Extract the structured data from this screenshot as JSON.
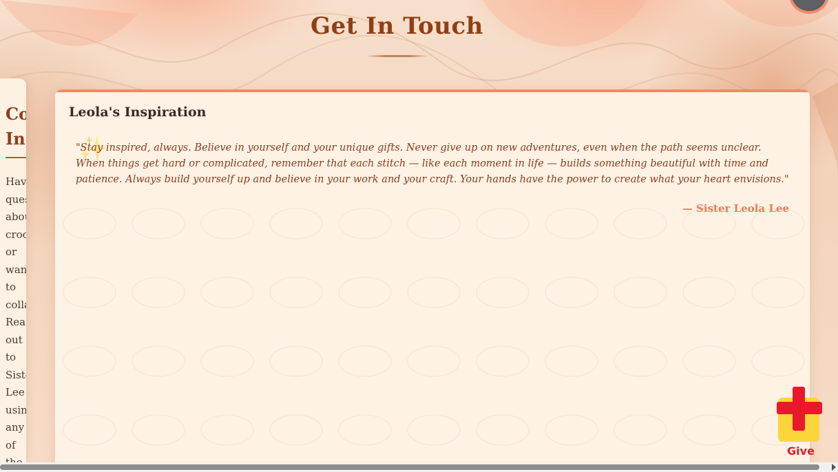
{
  "header": {
    "title": "Get In Touch"
  },
  "left_card": {
    "title": "Co\nIn",
    "text": "Hav\nques\nabou\ncroc\nor\nwan\nto\ncolla\nReac\nout\nto\nSiste\nLee\nusin\nany\nof\nthe"
  },
  "inspiration": {
    "title": "Leola's Inspiration",
    "quote": "\"Stay inspired, always. Believe in yourself and your unique gifts. Never give up on new adventures, even when the path seems unclear. When things get hard or complicated, remember that each stitch — like each moment in life — builds something beautiful with time and patience. Always build yourself up and believe in your work and your craft. Your hands have the power to create what your heart envisions.\"",
    "attribution": "— Sister Leola Lee",
    "icon": "sparkle-icon"
  },
  "give_widget": {
    "label": "Give",
    "icon": "gift-icon"
  },
  "colors": {
    "title": "#8f3f15",
    "accent": "#f28a62",
    "quote": "#8a3d1c",
    "give_red": "#e8192b",
    "give_yellow": "#fcd53a"
  }
}
